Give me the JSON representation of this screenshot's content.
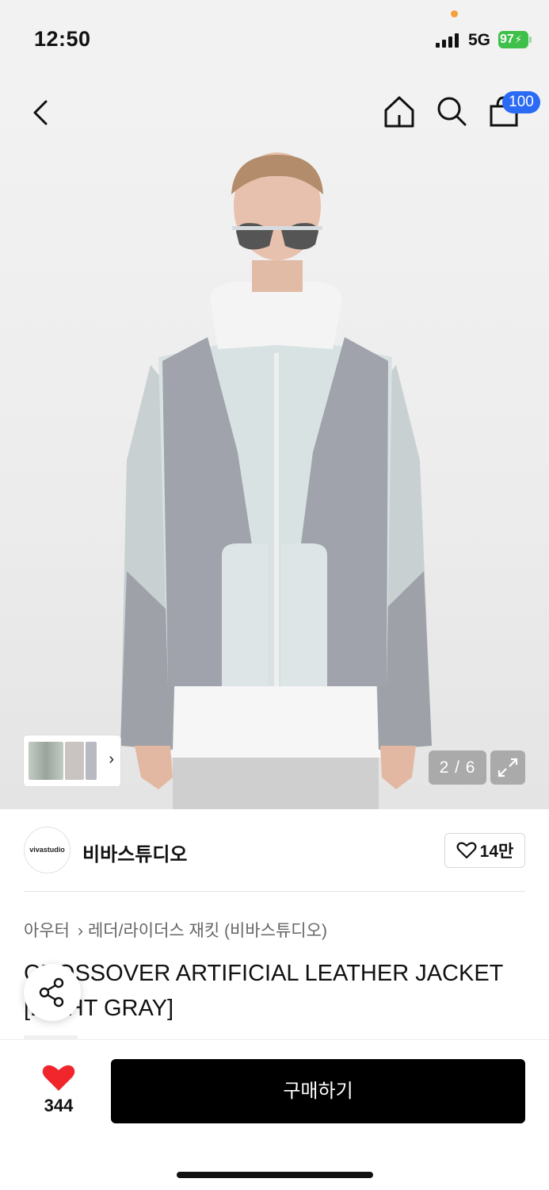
{
  "status_bar": {
    "time": "12:50",
    "network": "5G",
    "battery": "97"
  },
  "nav": {
    "cart_badge": "100"
  },
  "gallery": {
    "counter": "2 / 6"
  },
  "brand": {
    "logo_text": "vivastudio",
    "name": "비바스튜디오",
    "likes": "14만"
  },
  "breadcrumb": {
    "category": "아우터",
    "subcategory": "레더/라이더스 재킷 (비바스튜디오)"
  },
  "product": {
    "title": "CROSSOVER ARTIFICIAL LEATHER JACKET [LIGHT GRAY]"
  },
  "bottom": {
    "like_count": "344",
    "buy_label": "구매하기"
  },
  "colors": {
    "accent_badge": "#2a6af5",
    "heart": "#f0262c",
    "buy_button": "#000000",
    "battery": "#3ec04a"
  },
  "icons": [
    "back-icon",
    "home-icon",
    "search-icon",
    "cart-icon",
    "chevron-right-icon",
    "expand-icon",
    "heart-outline-icon",
    "share-icon",
    "heart-filled-icon"
  ]
}
